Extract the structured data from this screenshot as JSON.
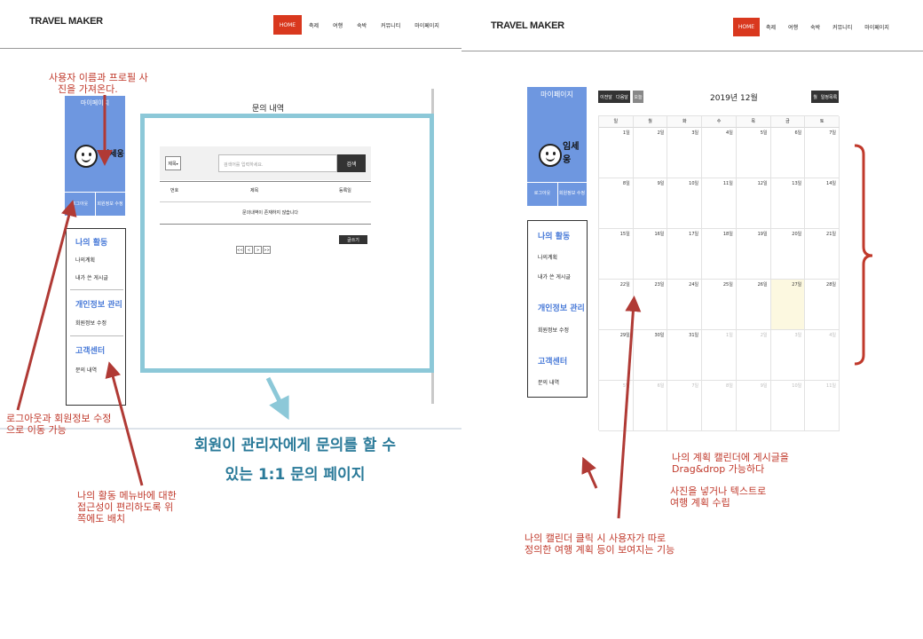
{
  "left": {
    "brand": "TRAVEL MAKER",
    "nav": [
      "HOME",
      "축제",
      "여행",
      "숙박",
      "커뮤니티",
      "마이페이지"
    ],
    "profile": {
      "title": "마이페이지",
      "name": "임세웅",
      "logout": "로그아웃",
      "edit": "회원정보 수정"
    },
    "menu": {
      "sections": [
        {
          "title": "나의 활동",
          "items": [
            "나의계획",
            "내가 쓴 게시글"
          ]
        },
        {
          "title": "개인정보 관리",
          "items": [
            "회원정보 수정"
          ]
        },
        {
          "title": "고객센터",
          "items": [
            "문의 내역"
          ]
        }
      ]
    },
    "inquiry": {
      "title": "문의 내역",
      "filter": "제목",
      "search_placeholder": "검색어를 입력하세요.",
      "search_btn": "검색",
      "columns": [
        "번호",
        "제목",
        "등록일"
      ],
      "empty": "문의내역이 존재하지 않습니다",
      "write_btn": "글쓰기",
      "pager": [
        "<<",
        "<",
        ">",
        ">>"
      ]
    },
    "caption_line1": "회원이 관리자에게 문의를 할 수",
    "caption_line2": "있는 1:1 문의 페이지",
    "annot_profile": [
      "사용자 이름과 프로필 사",
      "진을 가져온다."
    ],
    "annot_logout": [
      "로그아웃과 회원정보 수정",
      "으로 이동 가능"
    ],
    "annot_menu": [
      "나의 활동 메뉴바에 대한",
      "접근성이 편리하도록 위",
      "쪽에도 배치"
    ]
  },
  "right": {
    "brand": "TRAVEL MAKER",
    "nav": [
      "HOME",
      "축제",
      "여행",
      "숙박",
      "커뮤니티",
      "마이페이지"
    ],
    "profile": {
      "title": "마이페이지",
      "name": "임세웅",
      "logout": "로그아웃",
      "edit": "회원정보 수정"
    },
    "menu": {
      "sections": [
        {
          "title": "나의 활동",
          "items": [
            "나의계획",
            "내가 쓴 게시글"
          ]
        },
        {
          "title": "개인정보 관리",
          "items": [
            "회원정보 수정"
          ]
        },
        {
          "title": "고객센터",
          "items": [
            "문의 내역"
          ]
        }
      ]
    },
    "calendar": {
      "prev": "이전달",
      "next": "다음달",
      "today": "오늘",
      "month": "2019년 12월",
      "view_month": "월",
      "view_list": "일정목록",
      "weekdays": [
        "일",
        "월",
        "화",
        "수",
        "목",
        "금",
        "토"
      ],
      "weeks": [
        [
          "1일",
          "2일",
          "3일",
          "4일",
          "5일",
          "6일",
          "7일"
        ],
        [
          "8일",
          "9일",
          "10일",
          "11일",
          "12일",
          "13일",
          "14일"
        ],
        [
          "15일",
          "16일",
          "17일",
          "18일",
          "19일",
          "20일",
          "21일"
        ],
        [
          "22일",
          "23일",
          "24일",
          "25일",
          "26일",
          "27일",
          "28일"
        ],
        [
          "29일",
          "30일",
          "31일",
          "1일",
          "2일",
          "3일",
          "4일"
        ],
        [
          "5일",
          "6일",
          "7일",
          "8일",
          "9일",
          "10일",
          "11일"
        ]
      ]
    },
    "annot_drag": [
      "나의 계획 캘린더에 게시글을",
      "Drag&drop 가능하다"
    ],
    "annot_photo": [
      "사진을 넣거나 텍스트로",
      "여행 계획 수립"
    ],
    "annot_click": [
      "나의 캘린더 클릭 시 사용자가 따로",
      "정의한 여행 계획 등이 보여지는 기능"
    ]
  },
  "colors": {
    "accent_red": "#d9381e",
    "profile_blue": "#6e97e0",
    "frame_teal": "#8cc8d8",
    "annotation": "#c0392b",
    "caption": "#2a7a99"
  }
}
